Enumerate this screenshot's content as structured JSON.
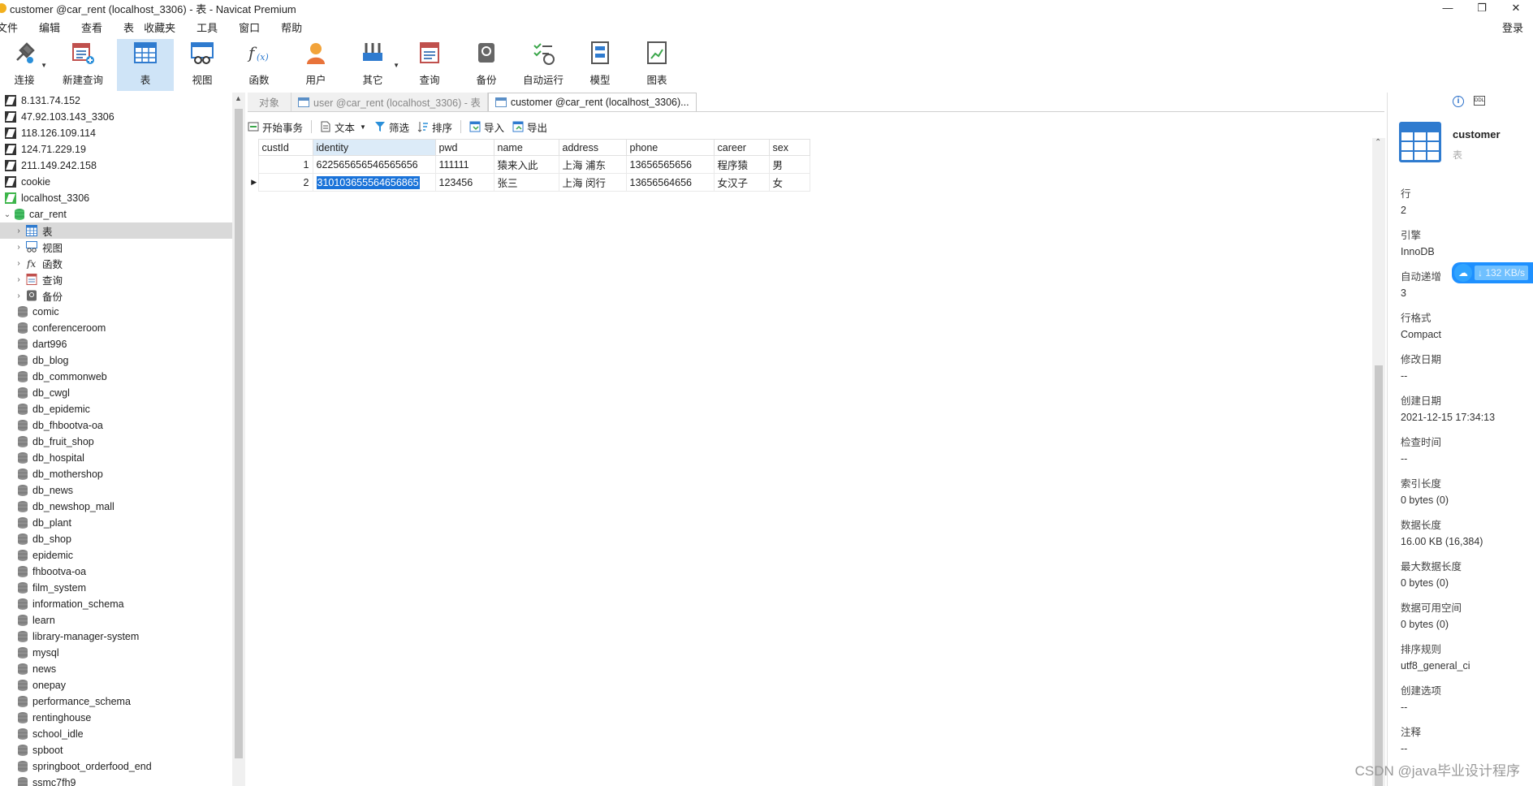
{
  "window": {
    "title": "customer @car_rent (localhost_3306) - 表 - Navicat Premium",
    "controls": [
      "—",
      "❐",
      "✕"
    ]
  },
  "menu": {
    "items": [
      "文件",
      "编辑",
      "查看",
      "表",
      "收藏夹",
      "工具",
      "窗口",
      "帮助"
    ],
    "login": "登录"
  },
  "toolbar": {
    "buttons": [
      {
        "label": "连接",
        "icon": "plug-icon"
      },
      {
        "label": "新建查询",
        "icon": "new-query-icon"
      },
      {
        "label": "表",
        "icon": "table-icon"
      },
      {
        "label": "视图",
        "icon": "view-icon"
      },
      {
        "label": "函数",
        "icon": "function-icon"
      },
      {
        "label": "用户",
        "icon": "user-icon"
      },
      {
        "label": "其它",
        "icon": "tools-icon"
      },
      {
        "label": "查询",
        "icon": "query-icon"
      },
      {
        "label": "备份",
        "icon": "backup-icon"
      },
      {
        "label": "自动运行",
        "icon": "schedule-icon"
      },
      {
        "label": "模型",
        "icon": "model-icon"
      },
      {
        "label": "图表",
        "icon": "chart-icon"
      }
    ]
  },
  "sidebar": {
    "connections": [
      "8.131.74.152",
      "47.92.103.143_3306",
      "118.126.109.114",
      "124.71.229.19",
      "211.149.242.158",
      "cookie",
      "localhost_3306"
    ],
    "open_db": "car_rent",
    "db_children": [
      "表",
      "视图",
      "函数",
      "查询",
      "备份"
    ],
    "databases": [
      "comic",
      "conferenceroom",
      "dart996",
      "db_blog",
      "db_commonweb",
      "db_cwgl",
      "db_epidemic",
      "db_fhbootva-oa",
      "db_fruit_shop",
      "db_hospital",
      "db_mothershop",
      "db_news",
      "db_newshop_mall",
      "db_plant",
      "db_shop",
      "epidemic",
      "fhbootva-oa",
      "film_system",
      "information_schema",
      "learn",
      "library-manager-system",
      "mysql",
      "news",
      "onepay",
      "performance_schema",
      "rentinghouse",
      "school_idle",
      "spboot",
      "springboot_orderfood_end",
      "ssmc7fh9"
    ]
  },
  "tabs": {
    "objects": "对象",
    "tab1": "user @car_rent (localhost_3306) - 表",
    "tab2": "customer @car_rent (localhost_3306)..."
  },
  "table_toolbar": {
    "begin_tx": "开始事务",
    "text": "文本",
    "filter": "筛选",
    "sort": "排序",
    "import": "导入",
    "export": "导出"
  },
  "grid": {
    "columns": [
      "custId",
      "identity",
      "pwd",
      "name",
      "address",
      "phone",
      "career",
      "sex"
    ],
    "rows": [
      [
        "1",
        "622565656546565656",
        "111111",
        "猿来入此",
        "上海 浦东",
        "13656565656",
        "程序猿",
        "男"
      ],
      [
        "2",
        "310103655564656865",
        "123456",
        "张三",
        "上海 闵行",
        "13656564656",
        "女汉子",
        "女"
      ]
    ]
  },
  "info": {
    "name": "customer",
    "type": "表",
    "props": [
      {
        "label": "行",
        "value": "2"
      },
      {
        "label": "引擎",
        "value": "InnoDB"
      },
      {
        "label": "自动递增",
        "value": "3"
      },
      {
        "label": "行格式",
        "value": "Compact"
      },
      {
        "label": "修改日期",
        "value": "--"
      },
      {
        "label": "创建日期",
        "value": "2021-12-15 17:34:13"
      },
      {
        "label": "检查时间",
        "value": "--"
      },
      {
        "label": "索引长度",
        "value": "0 bytes (0)"
      },
      {
        "label": "数据长度",
        "value": "16.00 KB (16,384)"
      },
      {
        "label": "最大数据长度",
        "value": "0 bytes (0)"
      },
      {
        "label": "数据可用空间",
        "value": "0 bytes (0)"
      },
      {
        "label": "排序规则",
        "value": "utf8_general_ci"
      },
      {
        "label": "创建选项",
        "value": "--"
      },
      {
        "label": "注释",
        "value": "--"
      }
    ]
  },
  "network_badge": "↓ 132 KB/s",
  "watermark": "CSDN @java毕业设计程序"
}
